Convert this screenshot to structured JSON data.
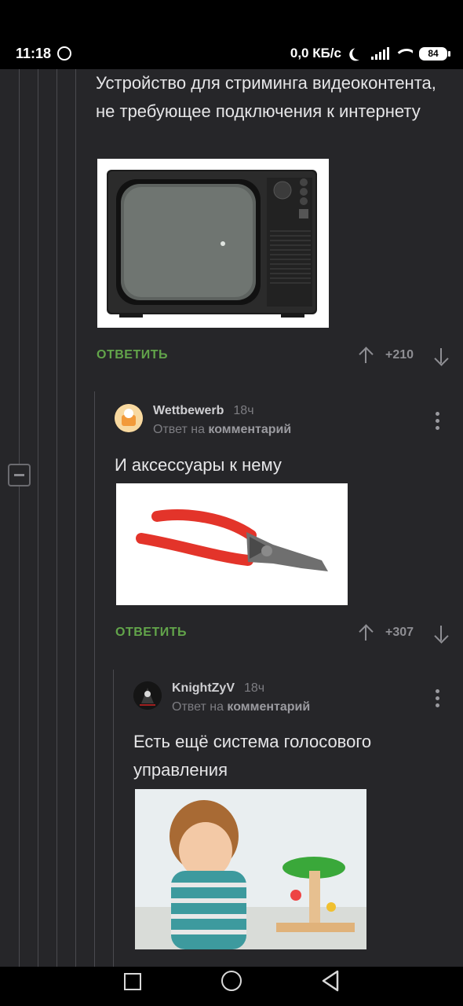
{
  "status": {
    "time": "11:18",
    "speed": "0,0 КБ/с",
    "battery": "84",
    "icons": [
      "whatsapp-icon",
      "moon-icon",
      "signal-icon",
      "wifi-icon",
      "battery-icon"
    ]
  },
  "comments": [
    {
      "text": "Устройство для стриминга видеоконтента, не требующее подключения к интернету",
      "image": "retro-tv-image",
      "reply_label": "ОТВЕТИТЬ",
      "score": "+210"
    },
    {
      "author": "Wettbewerb",
      "time": "18ч",
      "reply_prefix": "Ответ на",
      "reply_target": "комментарий",
      "text": "И аксессуары к нему",
      "image": "pliers-image",
      "reply_label": "ОТВЕТИТЬ",
      "score": "+307"
    },
    {
      "author": "KnightZyV",
      "time": "18ч",
      "reply_prefix": "Ответ на",
      "reply_target": "комментарий",
      "text": "Есть ещё система голосового управления",
      "image": "child-with-toy-image"
    }
  ],
  "colors": {
    "background": "#262629",
    "reply_green": "#62a44a",
    "text": "#e6e6e8",
    "muted": "#7d7d82"
  }
}
